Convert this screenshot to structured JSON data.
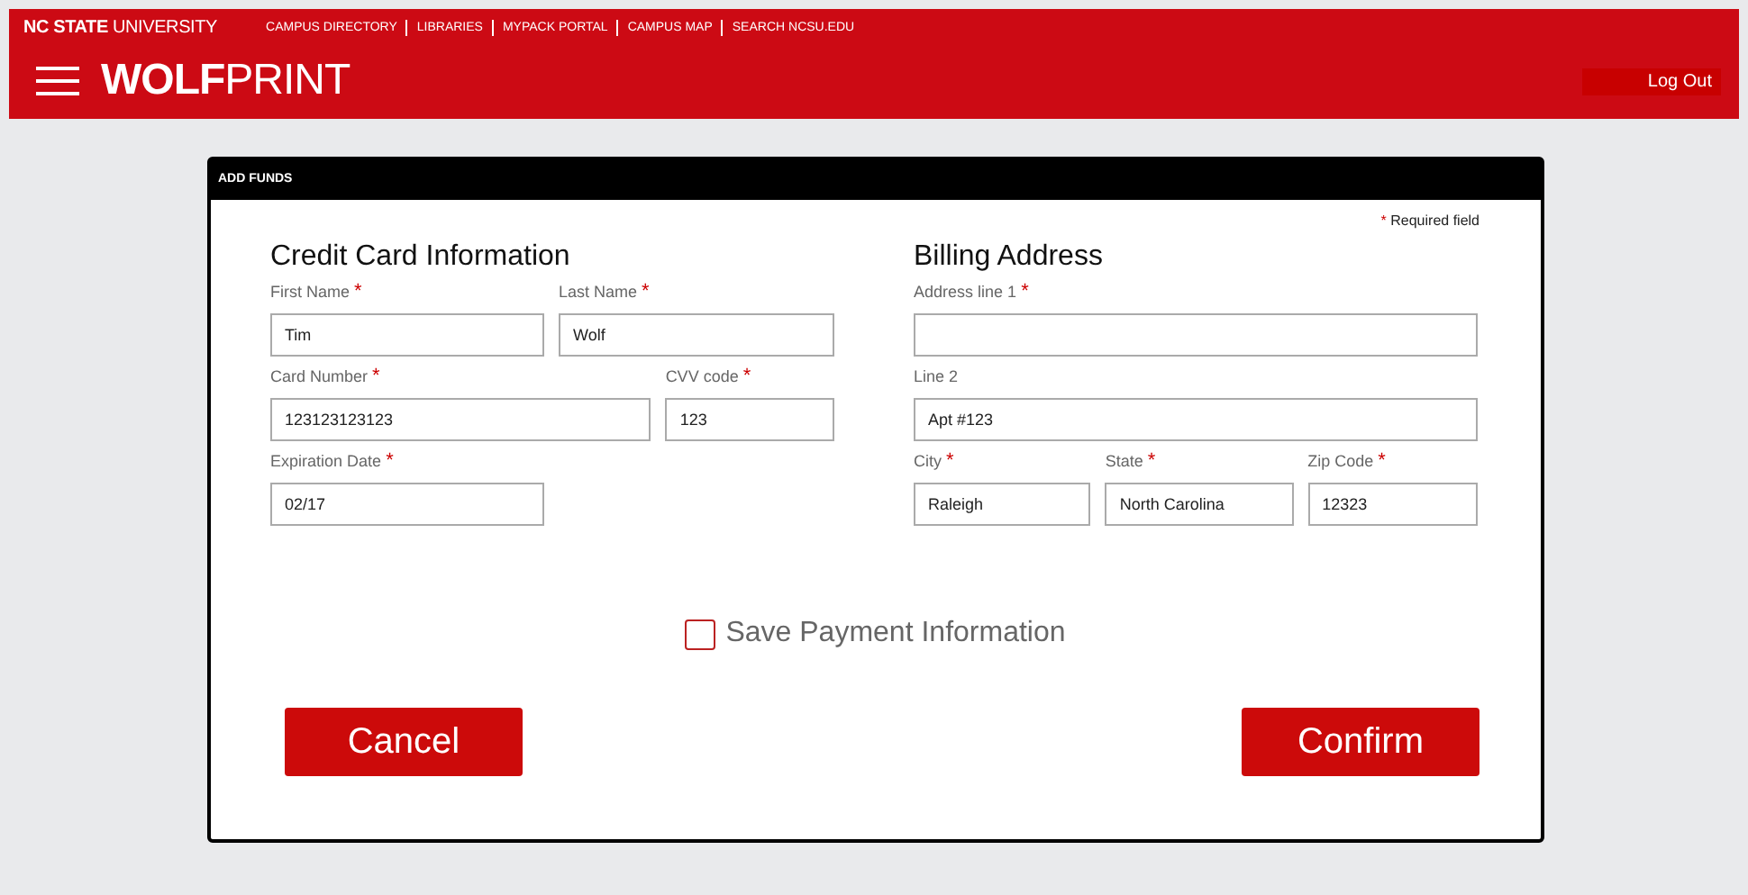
{
  "header": {
    "university": "**NC STATE** UNIVERSITY",
    "links": [
      "CAMPUS DIRECTORY",
      "LIBRARIES",
      "MYPACK PORTAL",
      "CAMPUS MAP",
      "SEARCH NCSU.EDU"
    ],
    "app_title": "**WOLF**PRINT",
    "logout": "Log Out"
  },
  "dialog": {
    "title": "ADD FUNDS",
    "required_note": {
      "mark": "*",
      "text": "Required field"
    },
    "sections": [
      {
        "heading": "Credit Card Information",
        "rows": [
          [
            {
              "label": "First Name",
              "mark": "*",
              "value": "Tim"
            },
            {
              "label": "Last Name",
              "mark": "*",
              "value": "Wolf"
            }
          ],
          [
            {
              "label": "Card Number",
              "mark": "*",
              "value": "123123123123"
            },
            {
              "label": "CVV code",
              "mark": "*",
              "value": "123"
            }
          ],
          [
            {
              "label": "Expiration Date",
              "mark": "*",
              "value": "02/17"
            }
          ]
        ]
      },
      {
        "heading": "Billing Address",
        "rows": [
          [
            {
              "label": "Address line 1",
              "mark": "*"
            }
          ],
          [
            {
              "label": "Line 2",
              "value": "Apt #123"
            }
          ],
          [
            {
              "label": "City",
              "mark": "*",
              "value": "Raleigh"
            },
            {
              "label": "State",
              "mark": "*",
              "value": "North Carolina"
            },
            {
              "label": "Zip Code",
              "mark": "*",
              "value": "12323"
            }
          ]
        ]
      }
    ],
    "save_payment": {
      "label": "Save Payment Information",
      "checked": false
    },
    "buttons": [
      "Cancel",
      "Confirm"
    ]
  }
}
